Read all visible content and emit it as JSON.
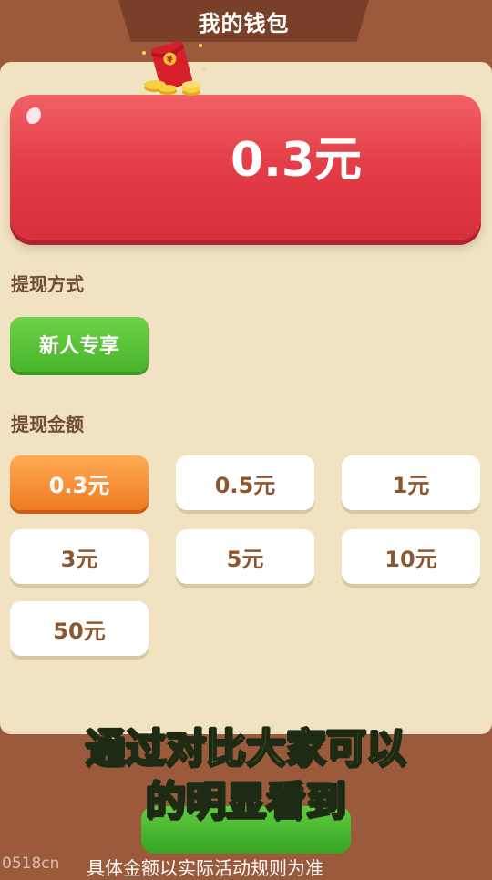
{
  "header": {
    "title": "我的钱包"
  },
  "balance": {
    "amount": "0.3元",
    "icon": "red-packet-icon"
  },
  "method": {
    "label": "提现方式",
    "option": "新人专享"
  },
  "amounts": {
    "label": "提现金额",
    "options": [
      "0.3元",
      "0.5元",
      "1元",
      "3元",
      "5元",
      "10元",
      "50元"
    ],
    "selected": "0.3元"
  },
  "overlay": {
    "caption_line1": "通过对比大家可以",
    "caption_line2": "的明显看到",
    "subtitle": "具体金额以实际活动规则为准",
    "watermark": "0518cn"
  },
  "colors": {
    "background": "#9c5a3c",
    "panel": "#f1e3c1",
    "balance_card": "#e23b45",
    "method_button": "#5ac23a",
    "selected_amount": "#f5913a",
    "caption": "#f5ea2c"
  }
}
